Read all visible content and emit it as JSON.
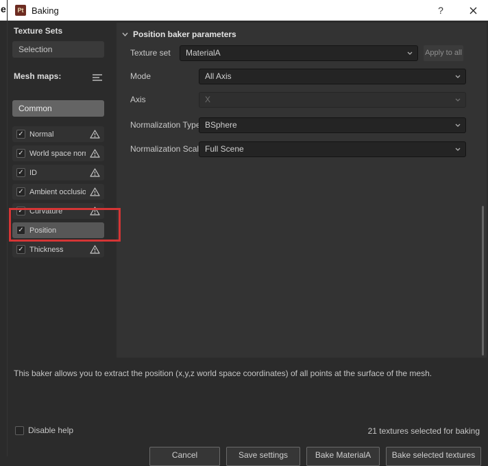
{
  "window": {
    "title": "Baking",
    "app_badge": "Pt",
    "help_label": "?"
  },
  "background_fragment": "e",
  "icons": {
    "check": "✓"
  },
  "sidebar": {
    "texture_sets_label": "Texture Sets",
    "selection_label": "Selection",
    "mesh_maps_label": "Mesh maps:",
    "common_label": "Common",
    "mesh_maps": [
      {
        "label": "Normal",
        "checked": true,
        "warning": true
      },
      {
        "label": "World space normal",
        "checked": true,
        "warning": true
      },
      {
        "label": "ID",
        "checked": true,
        "warning": true
      },
      {
        "label": "Ambient occlusion",
        "checked": true,
        "warning": true
      },
      {
        "label": "Curvature",
        "checked": true,
        "warning": true
      },
      {
        "label": "Position",
        "checked": true,
        "warning": false,
        "selected": true,
        "annotated": true
      },
      {
        "label": "Thickness",
        "checked": true,
        "warning": true
      }
    ]
  },
  "params": {
    "section_title": "Position baker parameters",
    "rows": [
      {
        "label": "Texture set",
        "value": "MaterialA",
        "extra_button": "Apply to all"
      },
      {
        "label": "Mode",
        "value": "All Axis"
      },
      {
        "label": "Axis",
        "value": "X",
        "disabled": true
      },
      {
        "label": "Normalization Type",
        "value": "BSphere"
      },
      {
        "label": "Normalization Scale",
        "value": "Full Scene"
      }
    ]
  },
  "footer": {
    "help_text": "This baker allows you to extract the position (x,y,z world space coordinates) of all points at the surface of the mesh.",
    "disable_help_label": "Disable help",
    "status_text": "21 textures selected for baking",
    "buttons": [
      "Cancel",
      "Save settings",
      "Bake MaterialA",
      "Bake selected textures"
    ]
  },
  "annotation": {
    "color": "#d53535"
  }
}
